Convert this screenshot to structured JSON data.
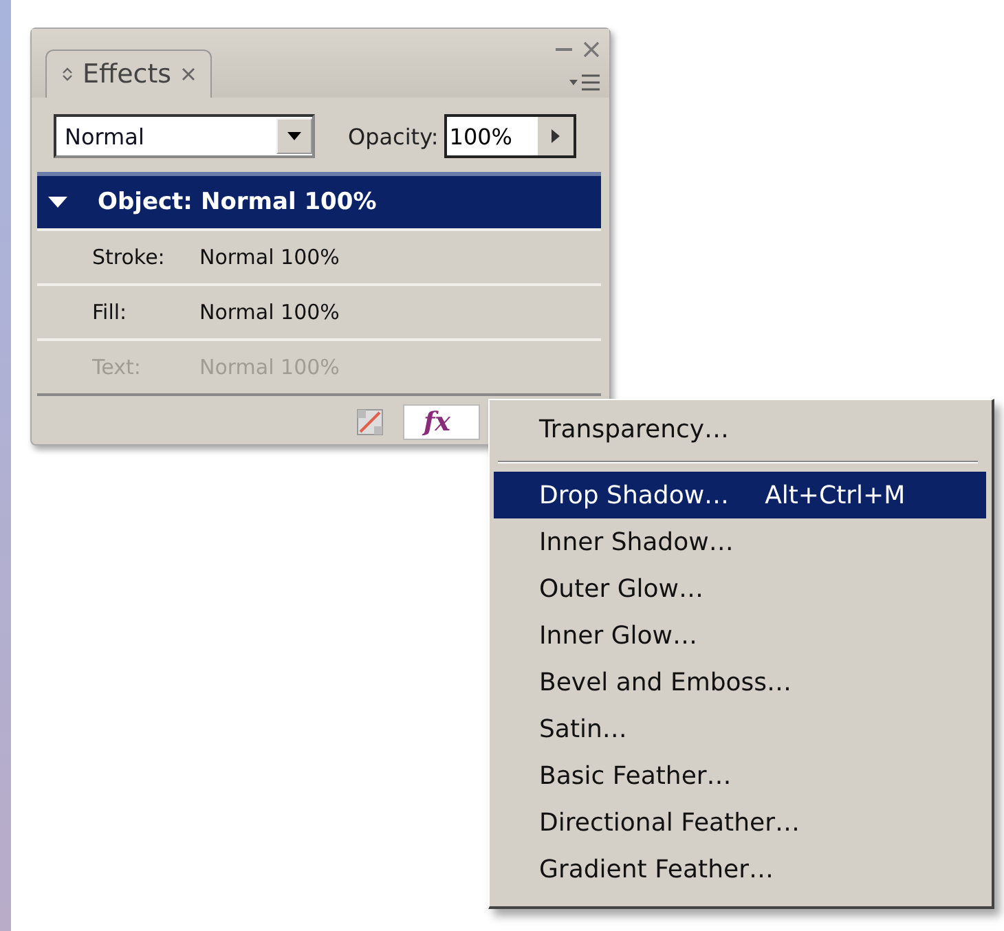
{
  "panel": {
    "tab": {
      "label": "Effects",
      "selected": true
    },
    "blend_mode": {
      "value": "Normal"
    },
    "opacity": {
      "label": "Opacity:",
      "value": "100%"
    },
    "rows": [
      {
        "label": "Object:",
        "value": "Normal 100%",
        "selected": true,
        "expanded": true,
        "disabled": false
      },
      {
        "label": "Stroke:",
        "value": "Normal 100%",
        "selected": false,
        "disabled": false
      },
      {
        "label": "Fill:",
        "value": "Normal 100%",
        "selected": false,
        "disabled": false
      },
      {
        "label": "Text:",
        "value": "Normal 100%",
        "selected": false,
        "disabled": true
      }
    ],
    "fx_button": {
      "label": "fx"
    }
  },
  "menu": {
    "items": [
      {
        "label": "Transparency…",
        "selected": false,
        "separator_after": true
      },
      {
        "label": "Drop Shadow…",
        "shortcut": "Alt+Ctrl+M",
        "selected": true
      },
      {
        "label": "Inner Shadow…",
        "selected": false
      },
      {
        "label": "Outer Glow…",
        "selected": false
      },
      {
        "label": "Inner Glow…",
        "selected": false
      },
      {
        "label": "Bevel and Emboss…",
        "selected": false
      },
      {
        "label": "Satin…",
        "selected": false
      },
      {
        "label": "Basic Feather…",
        "selected": false
      },
      {
        "label": "Directional Feather…",
        "selected": false
      },
      {
        "label": "Gradient Feather…",
        "selected": false
      }
    ]
  }
}
